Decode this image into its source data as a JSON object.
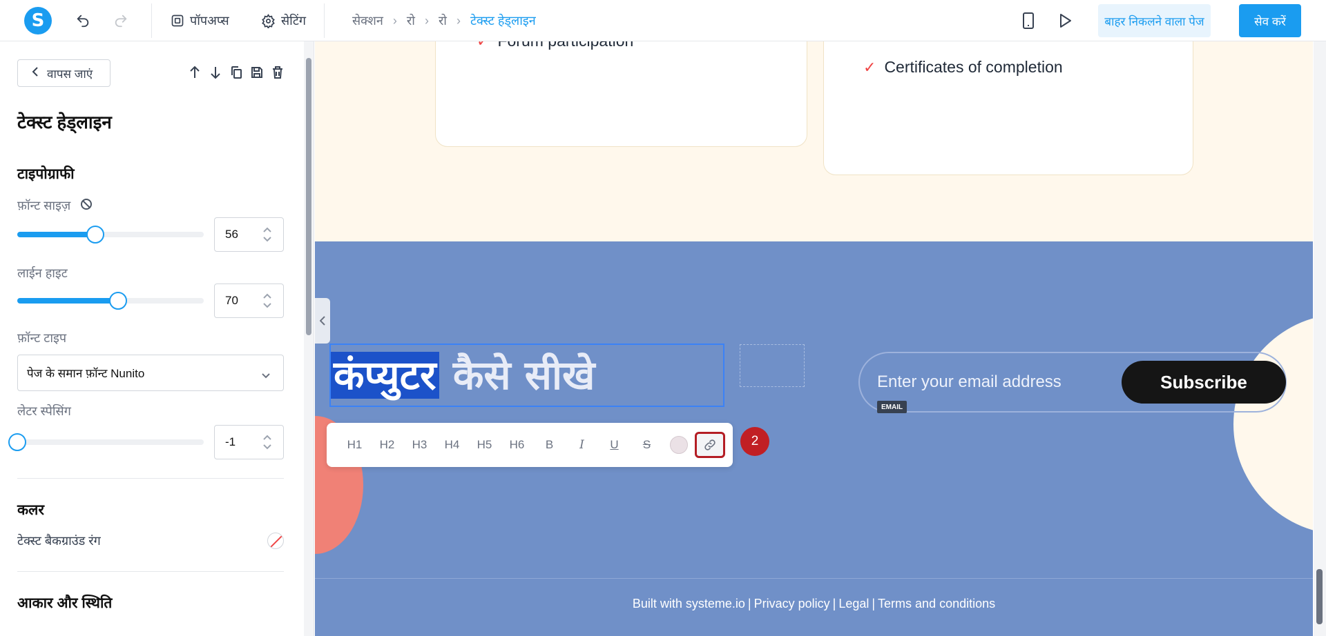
{
  "topbar": {
    "logo_letter": "S",
    "popups_label": "पॉपअप्स",
    "settings_label": "सेटिंग",
    "breadcrumb": [
      "सेक्शन",
      "रो",
      "रो",
      "टेक्स्ट हेड्लाइन"
    ],
    "exit_label": "बाहर निकलने वाला पेज",
    "save_label": "सेव करें"
  },
  "panel": {
    "back_label": "वापस जाएं",
    "title": "टेक्स्ट हेड्लाइन",
    "typography_title": "टाइपोग्राफी",
    "font_size_label": "फ़ॉन्ट साइज़",
    "font_size_value": "56",
    "font_size_fraction": 0.42,
    "line_height_label": "लाईन हाइट",
    "line_height_value": "70",
    "line_height_fraction": 0.54,
    "font_type_label": "फ़ॉन्ट टाइप",
    "font_type_value": "पेज के समान फ़ॉन्ट Nunito",
    "letter_spacing_label": "लेटर स्पेसिंग",
    "letter_spacing_value": "-1",
    "letter_spacing_fraction": 0.0,
    "color_title": "कलर",
    "text_bg_color_label": "टेक्स्ट बैकग्राउंड रंग",
    "size_position_title": "आकार और स्थिति"
  },
  "canvas": {
    "card_item_1": "Forum participation",
    "card_item_2": "Certificates of completion",
    "headline_selected": "कंप्युटर",
    "headline_rest": "कैसे सीखे",
    "email_placeholder": "Enter your email address",
    "email_tag": "EMAIL",
    "subscribe_label": "Subscribe",
    "toolbar_buttons": [
      "H1",
      "H2",
      "H3",
      "H4",
      "H5",
      "H6",
      "B",
      "I",
      "U",
      "S"
    ],
    "badge": "2",
    "footer": [
      "Built with systeme.io",
      "Privacy policy",
      "Legal",
      "Terms and conditions"
    ]
  },
  "colors": {
    "accent": "#1a9cf0",
    "section_blue": "#7090c8",
    "cream": "#fff8ec",
    "highlight": "#b41d24"
  }
}
